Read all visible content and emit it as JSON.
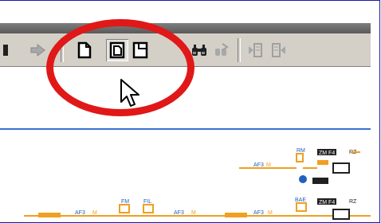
{
  "toolbar": {
    "buttons": [
      {
        "icon": "arrow-right-icon",
        "label": "",
        "state": "disabled"
      },
      {
        "icon": "document-icon",
        "label": "",
        "state": "normal"
      },
      {
        "icon": "document-stack-icon",
        "label": "",
        "state": "pressed"
      },
      {
        "icon": "document-corner-icon",
        "label": "",
        "state": "normal"
      },
      {
        "icon": "binoculars-icon",
        "label": "",
        "state": "normal"
      },
      {
        "icon": "replace-icon",
        "label": "",
        "state": "disabled"
      },
      {
        "icon": "navigate-back-icon",
        "label": "",
        "state": "disabled"
      },
      {
        "icon": "navigate-forward-icon",
        "label": "",
        "state": "disabled"
      }
    ]
  },
  "colors": {
    "callout": "#e01818",
    "toolbar": "#d4d0c8",
    "accent_line": "#3c6fd1",
    "diagram_orange": "#f0a020",
    "diagram_blue": "#2060c0"
  },
  "diagram": {
    "labels_top": [
      "AF3",
      "M",
      "RM",
      "ZM F4",
      "RZ"
    ],
    "labels_bottom": [
      "AF3",
      "M",
      "FM",
      "FIL",
      "AF3",
      "M",
      "AF3",
      "M",
      "BAE",
      "ZM F4",
      "RZ"
    ]
  }
}
